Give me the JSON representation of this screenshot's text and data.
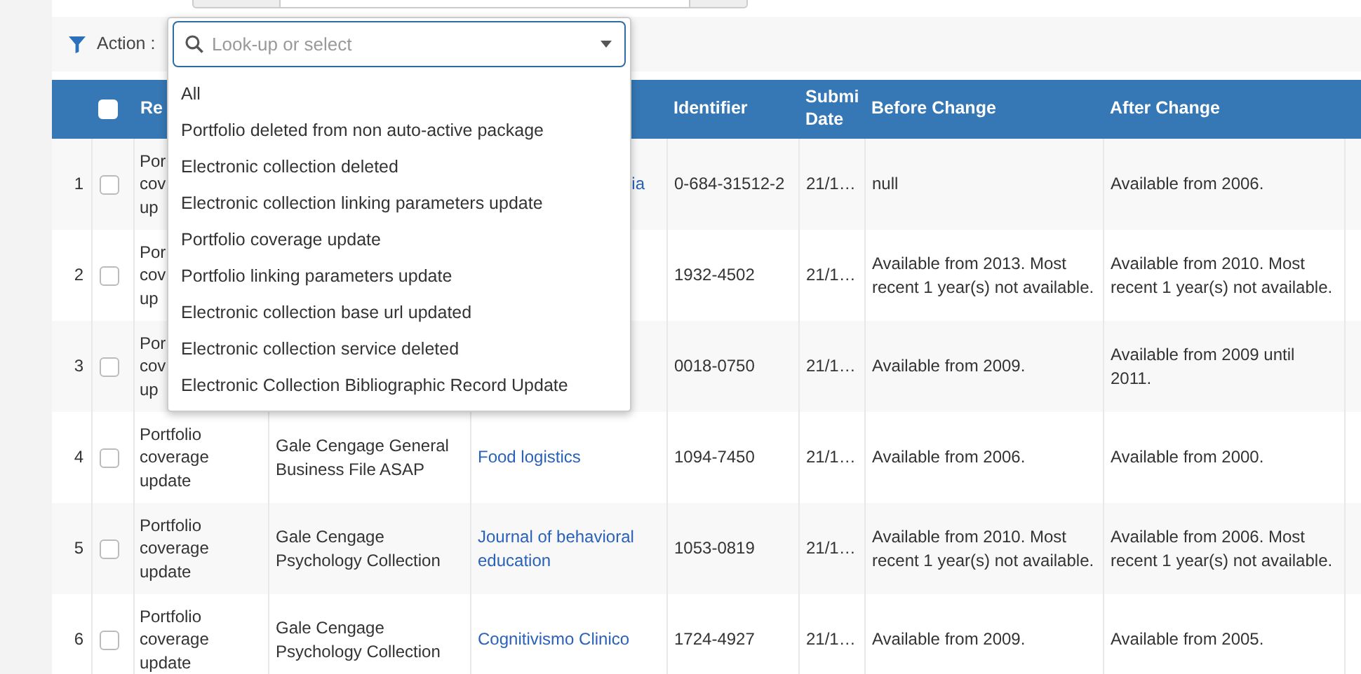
{
  "filter_bar": {
    "label": "Action :"
  },
  "action_dropdown": {
    "placeholder": "Look-up or select",
    "options": [
      {
        "label": "All"
      },
      {
        "label": "Portfolio deleted from non auto-active package"
      },
      {
        "label": "Electronic collection deleted"
      },
      {
        "label": "Electronic collection linking parameters update"
      },
      {
        "label": "Portfolio coverage update"
      },
      {
        "label": "Portfolio linking parameters update"
      },
      {
        "label": "Electronic collection base url updated"
      },
      {
        "label": "Electronic collection service deleted"
      },
      {
        "label": "Electronic Collection Bibliographic Record Update"
      }
    ]
  },
  "table": {
    "header_checkbox": {
      "checked": false
    },
    "headers": {
      "reason": "Re",
      "identifier": "Identifier",
      "submit_date": "Submi\nDate",
      "before_change": "Before Change",
      "after_change": "After Change"
    },
    "rows": [
      {
        "number": "1",
        "checked": false,
        "reason": "Por\ncov\nup",
        "title": "ia",
        "identifier": "0-684-31512-2",
        "submit_date": "21/1…",
        "before_change": "null",
        "after_change": "Available from 2006."
      },
      {
        "number": "2",
        "checked": false,
        "reason": "Por\ncov\nup",
        "identifier": "1932-4502",
        "submit_date": "21/1…",
        "before_change": "Available from 2013. Most recent 1 year(s) not available.",
        "after_change": "Available from 2010. Most recent 1 year(s) not available."
      },
      {
        "number": "3",
        "checked": false,
        "reason": "Por\ncov\nup",
        "identifier": "0018-0750",
        "submit_date": "21/1…",
        "before_change": "Available from 2009.",
        "after_change": "Available from 2009 until 2011."
      },
      {
        "number": "4",
        "checked": false,
        "reason": "Portfolio coverage update",
        "collection": "Gale Cengage General Business File ASAP",
        "title": "Food logistics",
        "identifier": "1094-7450",
        "submit_date": "21/1…",
        "before_change": "Available from 2006.",
        "after_change": "Available from 2000."
      },
      {
        "number": "5",
        "checked": false,
        "reason": "Portfolio coverage update",
        "collection": "Gale Cengage Psychology Collection",
        "title": "Journal of behavioral education",
        "identifier": "1053-0819",
        "submit_date": "21/1…",
        "before_change": "Available from 2010. Most recent 1 year(s) not available.",
        "after_change": "Available from 2006. Most recent 1 year(s) not available."
      },
      {
        "number": "6",
        "checked": false,
        "reason": "Portfolio coverage update",
        "collection": "Gale Cengage Psychology Collection",
        "title": "Cognitivismo Clinico",
        "identifier": "1724-4927",
        "submit_date": "21/1…",
        "before_change": "Available from 2009.",
        "after_change": "Available from 2005."
      }
    ]
  }
}
